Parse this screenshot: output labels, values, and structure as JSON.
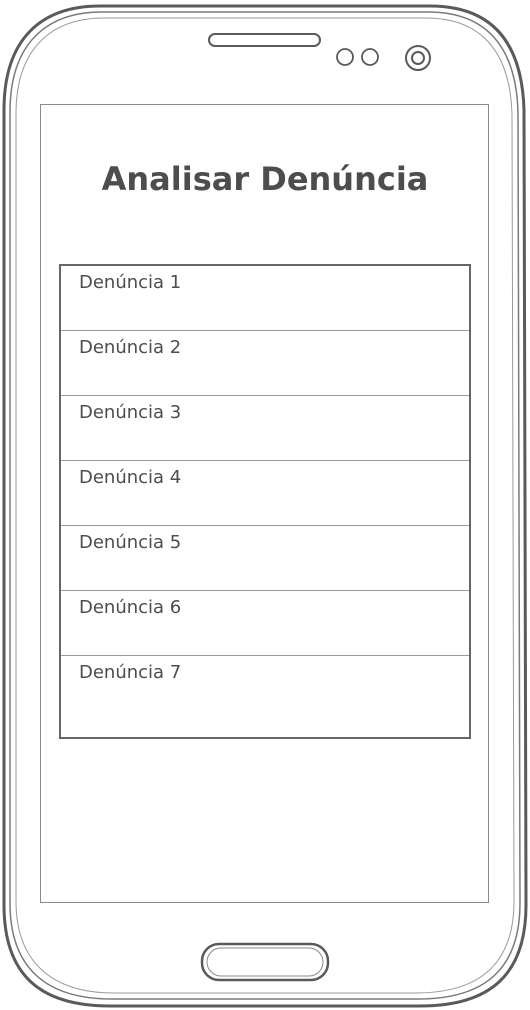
{
  "screen": {
    "title": "Analisar Denúncia"
  },
  "reports": {
    "items": [
      {
        "label": "Denúncia 1"
      },
      {
        "label": "Denúncia 2"
      },
      {
        "label": "Denúncia 3"
      },
      {
        "label": "Denúncia 4"
      },
      {
        "label": "Denúncia 5"
      },
      {
        "label": "Denúncia 6"
      },
      {
        "label": "Denúncia 7"
      }
    ]
  },
  "icons": {
    "speaker": "speaker-grille-icon",
    "sensors": "sensor-icon",
    "camera": "front-camera-icon",
    "home": "home-button-icon"
  },
  "colors": {
    "outline": "#5a5a5a",
    "text": "#4d4d4d",
    "divider": "#9a9a9a",
    "background": "#ffffff"
  }
}
